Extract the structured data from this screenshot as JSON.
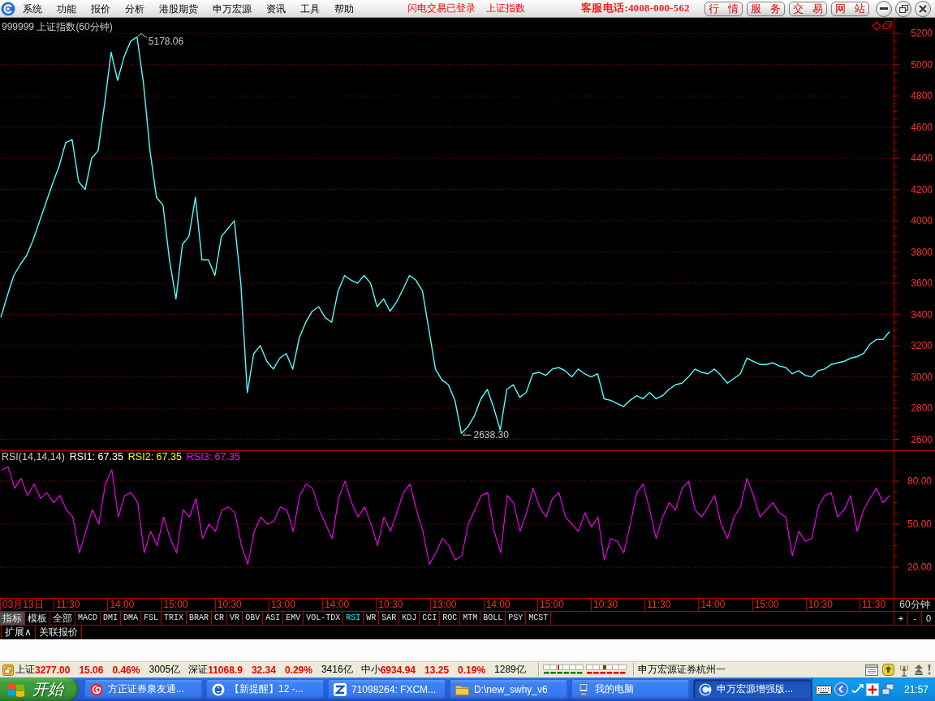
{
  "menu_bar": {
    "menus": [
      "系统",
      "功能",
      "报价",
      "分析",
      "港股期货",
      "申万宏源",
      "资讯",
      "工具",
      "帮助"
    ],
    "status_texts": [
      "闪电交易已登录",
      "上证指数"
    ],
    "hotline": "客服电话:4008-000-562",
    "buttons": [
      "行 情",
      "服 务",
      "交 易",
      "网 站"
    ]
  },
  "price_chart": {
    "chart_data": {
      "type": "line",
      "title": "999999 上证指数(60分钟)",
      "ylim": [
        2530,
        5300
      ],
      "yticks": [
        2600,
        2800,
        3000,
        3200,
        3400,
        3600,
        3800,
        4000,
        4200,
        4400,
        4600,
        4800,
        5000,
        5200
      ],
      "grid": true,
      "series": [
        {
          "color": "#54fcfc",
          "values": [
            3380,
            3520,
            3650,
            3720,
            3780,
            3880,
            4000,
            4120,
            4240,
            4350,
            4500,
            4520,
            4250,
            4200,
            4400,
            4450,
            4750,
            5080,
            4900,
            5050,
            5150,
            5178,
            4880,
            4450,
            4150,
            4100,
            3750,
            3500,
            3850,
            3900,
            4150,
            3750,
            3750,
            3650,
            3900,
            3950,
            4000,
            3600,
            2900,
            3150,
            3200,
            3100,
            3050,
            3120,
            3150,
            3050,
            3250,
            3350,
            3420,
            3450,
            3380,
            3350,
            3550,
            3650,
            3620,
            3600,
            3650,
            3600,
            3450,
            3500,
            3420,
            3480,
            3560,
            3650,
            3620,
            3550,
            3300,
            3050,
            2980,
            2950,
            2850,
            2638,
            2680,
            2750,
            2860,
            2920,
            2800,
            2660,
            2920,
            2950,
            2870,
            2900,
            3020,
            3030,
            3010,
            3050,
            3060,
            3040,
            3000,
            3050,
            3020,
            3000,
            3020,
            2860,
            2850,
            2830,
            2810,
            2850,
            2880,
            2860,
            2900,
            2860,
            2880,
            2920,
            2950,
            2960,
            3000,
            3050,
            3030,
            3020,
            3050,
            3010,
            2960,
            2990,
            3020,
            3120,
            3100,
            3080,
            3080,
            3090,
            3070,
            3060,
            3020,
            3040,
            3010,
            3000,
            3040,
            3050,
            3080,
            3090,
            3100,
            3120,
            3130,
            3150,
            3210,
            3240,
            3240,
            3290
          ]
        }
      ],
      "annotations": [
        "5178.06",
        "2638.30"
      ]
    }
  },
  "indicator_chart": {
    "readings": [
      {
        "label": "RSI1: 67.35",
        "color": "#ffffff"
      },
      {
        "label": "RSI2: 67.35",
        "color": "#ffff00"
      }
    ],
    "chart_data": {
      "type": "line",
      "title": "RSI(14,14,14)",
      "ylim": [
        -1.5,
        101
      ],
      "yticks": [
        {
          "value": 20,
          "label": "20.00"
        },
        {
          "value": 50,
          "label": "50.00"
        },
        {
          "value": 80,
          "label": "80.00"
        }
      ],
      "grid": true,
      "series": [
        {
          "name": "RSI3: 67.35",
          "color": "#ff00ff",
          "values": [
            88,
            90,
            75,
            82,
            70,
            78,
            68,
            72,
            65,
            70,
            60,
            55,
            30,
            45,
            60,
            50,
            78,
            88,
            55,
            70,
            72,
            65,
            30,
            45,
            35,
            55,
            40,
            30,
            60,
            55,
            68,
            40,
            50,
            45,
            60,
            62,
            58,
            35,
            22,
            45,
            55,
            50,
            52,
            62,
            60,
            45,
            70,
            78,
            75,
            60,
            50,
            40,
            68,
            80,
            65,
            55,
            62,
            50,
            35,
            55,
            45,
            58,
            72,
            78,
            60,
            45,
            22,
            30,
            40,
            35,
            25,
            28,
            50,
            60,
            70,
            72,
            45,
            30,
            70,
            65,
            45,
            58,
            75,
            62,
            55,
            68,
            72,
            55,
            50,
            45,
            58,
            48,
            55,
            25,
            40,
            38,
            30,
            50,
            72,
            78,
            60,
            40,
            55,
            65,
            60,
            75,
            80,
            60,
            55,
            62,
            70,
            50,
            40,
            55,
            62,
            82,
            70,
            55,
            60,
            65,
            58,
            55,
            28,
            45,
            38,
            40,
            62,
            70,
            72,
            55,
            60,
            70,
            45,
            60,
            68,
            75,
            65,
            70
          ]
        }
      ]
    }
  },
  "time_axis": {
    "labels": [
      "03月13日",
      "11:30",
      "14:00",
      "15:00",
      "10:30",
      "13:00",
      "14:00",
      "10:30",
      "13:00",
      "14:00",
      "15:00",
      "10:30",
      "11:30",
      "14:00",
      "15:00",
      "10:30",
      "11:30"
    ],
    "period": "60分钟"
  },
  "indicator_bar": {
    "tabs": [
      {
        "label": "指标",
        "kind": "mode",
        "selected": true
      },
      {
        "label": "模板",
        "kind": "mode",
        "selected": false
      },
      {
        "label": "全部",
        "kind": "mode",
        "selected": false
      },
      {
        "label": "MACD",
        "kind": "indicator",
        "selected": false
      },
      {
        "label": "DMI",
        "kind": "indicator",
        "selected": false
      },
      {
        "label": "DMA",
        "kind": "indicator",
        "selected": false
      },
      {
        "label": "FSL",
        "kind": "indicator",
        "selected": false
      },
      {
        "label": "TRIX",
        "kind": "indicator",
        "selected": false
      },
      {
        "label": "BRAR",
        "kind": "indicator",
        "selected": false
      },
      {
        "label": "CR",
        "kind": "indicator",
        "selected": false
      },
      {
        "label": "VR",
        "kind": "indicator",
        "selected": false
      },
      {
        "label": "OBV",
        "kind": "indicator",
        "selected": false
      },
      {
        "label": "ASI",
        "kind": "indicator",
        "selected": false
      },
      {
        "label": "EMV",
        "kind": "indicator",
        "selected": false
      },
      {
        "label": "VOL-TDX",
        "kind": "indicator",
        "selected": false
      },
      {
        "label": "RSI",
        "kind": "indicator",
        "selected": true
      },
      {
        "label": "WR",
        "kind": "indicator",
        "selected": false
      },
      {
        "label": "SAR",
        "kind": "indicator",
        "selected": false
      },
      {
        "label": "KDJ",
        "kind": "indicator",
        "selected": false
      },
      {
        "label": "CCI",
        "kind": "indicator",
        "selected": false
      },
      {
        "label": "ROC",
        "kind": "indicator",
        "selected": false
      },
      {
        "label": "MTM",
        "kind": "indicator",
        "selected": false
      },
      {
        "label": "BOLL",
        "kind": "indicator",
        "selected": false
      },
      {
        "label": "PSY",
        "kind": "indicator",
        "selected": false
      },
      {
        "label": "MCST",
        "kind": "indicator",
        "selected": false
      }
    ],
    "zoom_buttons": [
      "+",
      "-",
      "0"
    ]
  },
  "extra_tabs": [
    "扩展∧",
    "关联报价"
  ],
  "status_bar": {
    "indices": [
      {
        "name": "上证",
        "value": "3277.00",
        "change": "15.06",
        "percent": "0.46%",
        "amount": "3005亿"
      },
      {
        "name": "深证",
        "value": "11068.9",
        "change": "32.34",
        "percent": "0.29%",
        "amount": "3416亿"
      },
      {
        "name": "中小",
        "value": "6934.94",
        "change": "13.25",
        "percent": "0.19%",
        "amount": "1289亿"
      }
    ],
    "server": "申万宏源证券杭州一"
  },
  "taskbar": {
    "start_label": "开始",
    "tasks": [
      {
        "label": "方正证券泉友通...",
        "selected": false
      },
      {
        "label": "【新提醒】12 -...",
        "selected": false
      },
      {
        "label": "71098264: FXCM...",
        "selected": false
      },
      {
        "label": "D:\\new_swhy_v6",
        "selected": false
      },
      {
        "label": "我的电脑",
        "selected": false
      },
      {
        "label": "申万宏源增强版...",
        "selected": true
      }
    ],
    "clock": "21:57"
  }
}
